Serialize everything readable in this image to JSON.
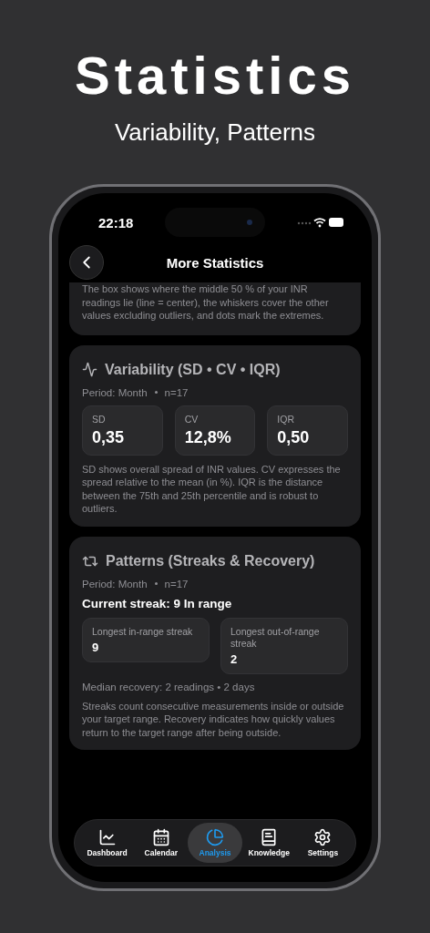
{
  "hero": {
    "title": "Statistics",
    "subtitle": "Variability, Patterns"
  },
  "status_bar": {
    "time": "22:18"
  },
  "nav": {
    "title": "More Statistics"
  },
  "box_note": {
    "text": "The box shows where the middle 50 % of your INR readings lie (line = center), the whiskers cover the other values excluding outliers, and dots mark the extremes."
  },
  "variability": {
    "title": "Variability (SD • CV • IQR)",
    "period": "Period: Month",
    "count": "n=17",
    "metrics": [
      {
        "label": "SD",
        "value": "0,35"
      },
      {
        "label": "CV",
        "value": "12,8%"
      },
      {
        "label": "IQR",
        "value": "0,50"
      }
    ],
    "note": "SD shows overall spread of INR values. CV expresses the spread relative to the mean (in %). IQR is the distance between the 75th and 25th percentile and is robust to outliers."
  },
  "patterns": {
    "title": "Patterns (Streaks & Recovery)",
    "period": "Period: Month",
    "count": "n=17",
    "current_streak": "Current streak: 9 In range",
    "metrics": [
      {
        "label": "Longest in-range streak",
        "value": "9"
      },
      {
        "label": "Longest out-of-range streak",
        "value": "2"
      }
    ],
    "recovery": "Median recovery: 2 readings • 2 days",
    "note": "Streaks count consecutive measurements inside or outside your target range. Recovery indicates how quickly values return to the target range after being outside."
  },
  "tab_bar": {
    "items": [
      {
        "label": "Dashboard",
        "selected": false
      },
      {
        "label": "Calendar",
        "selected": false
      },
      {
        "label": "Analysis",
        "selected": true
      },
      {
        "label": "Knowledge",
        "selected": false
      },
      {
        "label": "Settings",
        "selected": false
      }
    ]
  }
}
